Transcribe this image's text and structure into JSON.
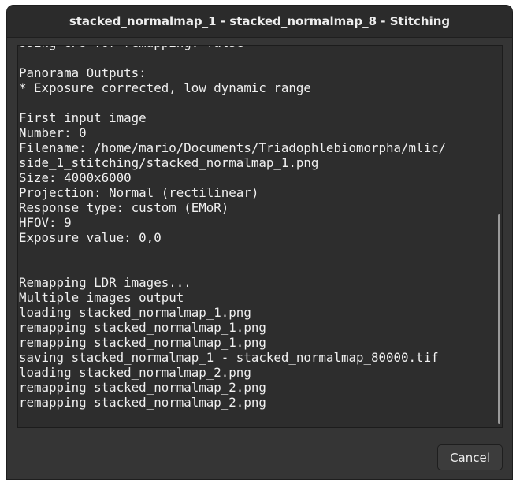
{
  "window": {
    "title": "stacked_normalmap_1 - stacked_normalmap_8 - Stitching"
  },
  "log": {
    "lines": [
      "Using GPU for remapping: false",
      "",
      "Panorama Outputs:",
      "* Exposure corrected, low dynamic range",
      "",
      "First input image",
      "Number: 0",
      "Filename: /home/mario/Documents/Triadophlebiomorpha/mlic/",
      "side_1_stitching/stacked_normalmap_1.png",
      "Size: 4000x6000",
      "Projection: Normal (rectilinear)",
      "Response type: custom (EMoR)",
      "HFOV: 9",
      "Exposure value: 0,0",
      "",
      "",
      "Remapping LDR images...",
      "Multiple images output",
      "loading stacked_normalmap_1.png",
      "remapping stacked_normalmap_1.png",
      "remapping stacked_normalmap_1.png",
      "saving stacked_normalmap_1 - stacked_normalmap_80000.tif",
      "loading stacked_normalmap_2.png",
      "remapping stacked_normalmap_2.png",
      "remapping stacked_normalmap_2.png"
    ]
  },
  "buttons": {
    "cancel_label": "Cancel"
  },
  "colors": {
    "window_bg": "#353535",
    "log_bg": "#2d2d2d",
    "text": "#f0f0f0"
  }
}
